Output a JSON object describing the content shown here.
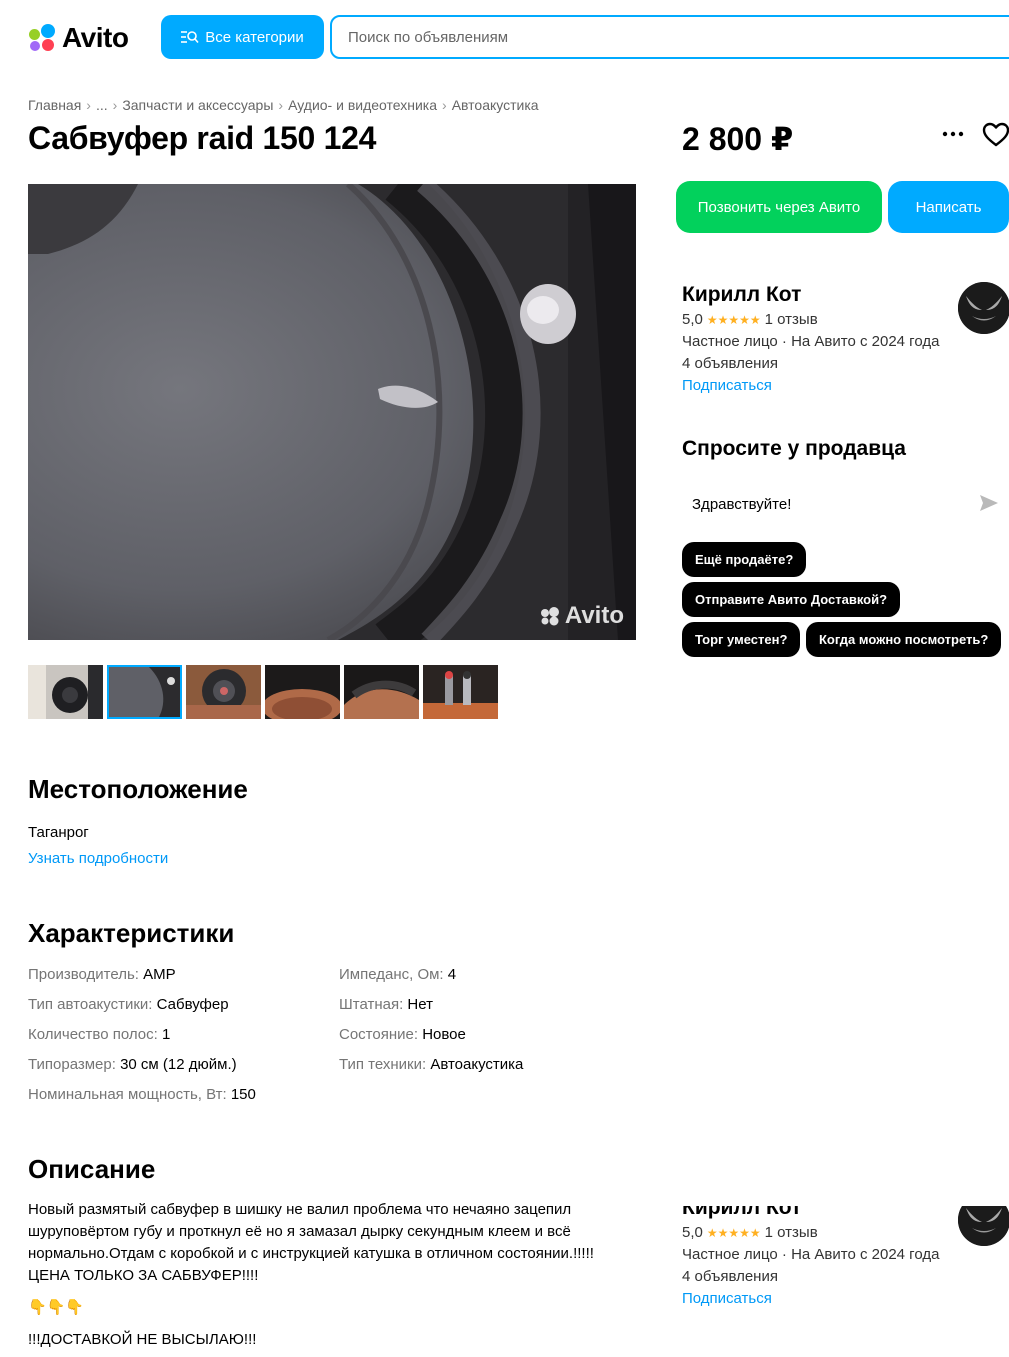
{
  "header": {
    "logo_text": "Avito",
    "categories_label": "Все категории",
    "search_placeholder": "Поиск по объявлениям"
  },
  "breadcrumb": [
    "Главная",
    "...",
    "Запчасти и аксессуары",
    "Аудио- и видеотехника",
    "Автоакустика"
  ],
  "listing": {
    "title": "Сабвуфер raid 150 124",
    "price": "2 800 ₽",
    "watermark": "Avito",
    "thumbnail_count": 6,
    "active_thumbnail": 2
  },
  "actions": {
    "call": "Позвонить через Авито",
    "write": "Написать"
  },
  "seller": {
    "name": "Кирилл Кот",
    "rating": "5,0",
    "stars": "★★★★★",
    "reviews": "1 отзыв",
    "type": "Частное лицо · На Авито с 2024 года",
    "ads": "4 объявления",
    "subscribe": "Подписаться"
  },
  "ask": {
    "title": "Спросите у продавца",
    "input_value": "Здравствуйте!",
    "chips": [
      "Ещё продаёте?",
      "Отправите Авито Доставкой?",
      "Торг уместен?",
      "Когда можно посмотреть?"
    ]
  },
  "location": {
    "title": "Местоположение",
    "city": "Таганрог",
    "details_link": "Узнать подробности"
  },
  "specs": {
    "title": "Характеристики",
    "left": [
      {
        "key": "Производитель: ",
        "value": "AMP"
      },
      {
        "key": "Тип автоакустики: ",
        "value": "Сабвуфер"
      },
      {
        "key": "Количество полос: ",
        "value": "1"
      },
      {
        "key": "Типоразмер: ",
        "value": "30 см (12 дюйм.)"
      },
      {
        "key": "Номинальная мощность, Вт: ",
        "value": "150"
      }
    ],
    "right": [
      {
        "key": "Импеданс, Ом: ",
        "value": "4"
      },
      {
        "key": "Штатная: ",
        "value": "Нет"
      },
      {
        "key": "Состояние: ",
        "value": "Новое"
      },
      {
        "key": "Тип техники: ",
        "value": "Автоакустика"
      }
    ]
  },
  "description": {
    "title": "Описание",
    "p1": "Новый размятый сабвуфер в шишку не валил проблема что нечаяно зацепил шуруповёртом губу и проткнул её но я замазал дырку секундным клеем и всё нормально.Отдам с коробкой и с инструкцией катушка в отличном состоянии.!!!!! ЦЕНА ТОЛЬКО ЗА САБВУФЕР!!!!",
    "p2": "👇👇👇",
    "p3": "!!!ДОСТАВКОЙ НЕ ВЫСЫЛАЮ!!!"
  },
  "colors": {
    "accent": "#00aaff",
    "call_green": "#02d15c",
    "link": "#0099f7",
    "star": "#ffb021"
  }
}
